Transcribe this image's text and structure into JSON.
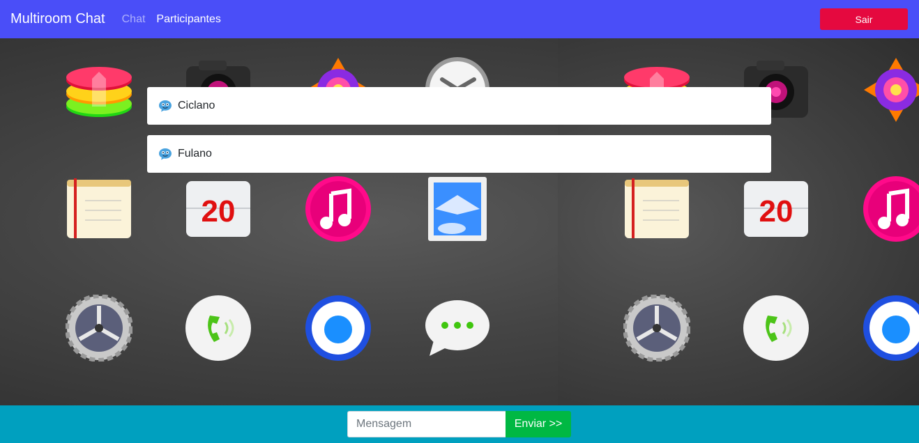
{
  "navbar": {
    "brand": "Multiroom Chat",
    "links": [
      "Chat",
      "Participantes"
    ],
    "exit_label": "Sair"
  },
  "participants": [
    {
      "name": "Ciclano",
      "icon": "chat-bubble-face-icon"
    },
    {
      "name": "Fulano",
      "icon": "chat-bubble-face-icon"
    }
  ],
  "wallpaper": {
    "calendar_number": "20",
    "icons": [
      "layers-icon",
      "camera-icon",
      "photos-icon",
      "clock-icon",
      "notes-icon",
      "calendar-icon",
      "music-icon",
      "mail-stamp-icon",
      "settings-gear-icon",
      "phone-icon",
      "browser-icon",
      "messages-icon"
    ]
  },
  "footer": {
    "message_placeholder": "Mensagem",
    "send_label": "Enviar >>"
  },
  "colors": {
    "navbar": "#4a4ef8",
    "exit_button": "#e5093f",
    "footer": "#00a0bf",
    "send_button": "#00b843"
  }
}
